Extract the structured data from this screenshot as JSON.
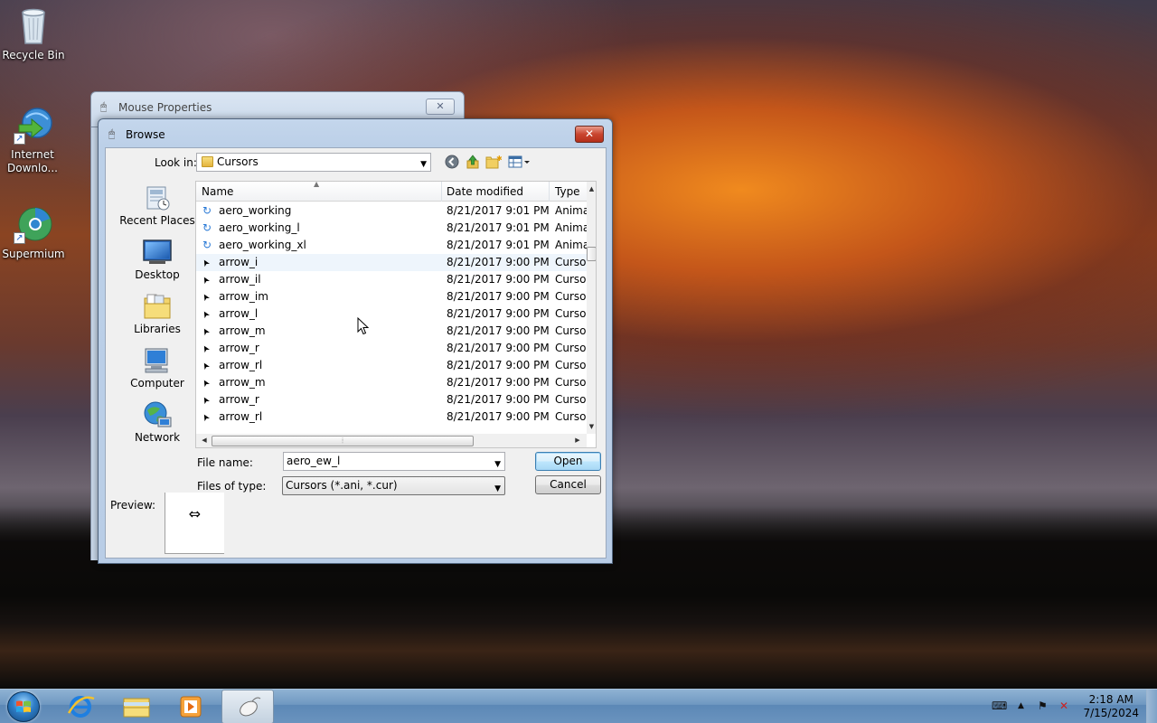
{
  "desktop": {
    "icons": [
      {
        "label": "Recycle Bin",
        "icon": "recycle-bin-icon"
      },
      {
        "label": "Internet Downlo...",
        "icon": "internet-download-manager-icon"
      },
      {
        "label": "Supermium",
        "icon": "supermium-browser-icon"
      }
    ]
  },
  "back_window": {
    "title": "Mouse Properties",
    "close_label": "✕"
  },
  "dialog": {
    "title": "Browse",
    "close_label": "✕",
    "look_in_label": "Look in:",
    "look_in_value": "Cursors",
    "toolbar_icons": [
      "back-icon",
      "up-folder-icon",
      "new-folder-icon",
      "views-menu-icon"
    ],
    "places": [
      {
        "label": "Recent Places",
        "icon": "recent-places-icon"
      },
      {
        "label": "Desktop",
        "icon": "desktop-icon"
      },
      {
        "label": "Libraries",
        "icon": "libraries-icon"
      },
      {
        "label": "Computer",
        "icon": "computer-icon"
      },
      {
        "label": "Network",
        "icon": "network-icon"
      }
    ],
    "columns": {
      "name": "Name",
      "date": "Date modified",
      "type": "Type"
    },
    "files": [
      {
        "name": "aero_working",
        "date": "8/21/2017 9:01 PM",
        "type": "Anima",
        "icon": "animated-cursor-icon"
      },
      {
        "name": "aero_working_l",
        "date": "8/21/2017 9:01 PM",
        "type": "Anima",
        "icon": "animated-cursor-icon"
      },
      {
        "name": "aero_working_xl",
        "date": "8/21/2017 9:01 PM",
        "type": "Anima",
        "icon": "animated-cursor-icon"
      },
      {
        "name": "arrow_i",
        "date": "8/21/2017 9:00 PM",
        "type": "Cursor",
        "icon": "arrow-cursor-icon"
      },
      {
        "name": "arrow_il",
        "date": "8/21/2017 9:00 PM",
        "type": "Cursor",
        "icon": "arrow-cursor-icon"
      },
      {
        "name": "arrow_im",
        "date": "8/21/2017 9:00 PM",
        "type": "Cursor",
        "icon": "arrow-cursor-icon"
      },
      {
        "name": "arrow_l",
        "date": "8/21/2017 9:00 PM",
        "type": "Cursor",
        "icon": "arrow-cursor-icon"
      },
      {
        "name": "arrow_m",
        "date": "8/21/2017 9:00 PM",
        "type": "Cursor",
        "icon": "arrow-cursor-icon"
      },
      {
        "name": "arrow_r",
        "date": "8/21/2017 9:00 PM",
        "type": "Cursor",
        "icon": "arrow-cursor-icon"
      },
      {
        "name": "arrow_rl",
        "date": "8/21/2017 9:00 PM",
        "type": "Cursor",
        "icon": "arrow-cursor-icon"
      },
      {
        "name": "arrow_m",
        "date": "8/21/2017 9:00 PM",
        "type": "Cursor",
        "icon": "arrow-cursor-icon"
      },
      {
        "name": "arrow_r",
        "date": "8/21/2017 9:00 PM",
        "type": "Cursor",
        "icon": "arrow-cursor-icon"
      },
      {
        "name": "arrow_rl",
        "date": "8/21/2017 9:00 PM",
        "type": "Cursor",
        "icon": "arrow-cursor-icon"
      }
    ],
    "file_name_label": "File name:",
    "file_name_value": "aero_ew_l",
    "files_of_type_label": "Files of type:",
    "files_of_type_value": "Cursors (*.ani, *.cur)",
    "open_label": "Open",
    "cancel_label": "Cancel",
    "preview_label": "Preview:",
    "preview_glyph": "⇔"
  },
  "taskbar": {
    "items": [
      {
        "icon": "internet-explorer-icon"
      },
      {
        "icon": "file-explorer-icon"
      },
      {
        "icon": "media-player-icon"
      },
      {
        "icon": "mouse-properties-icon"
      }
    ],
    "time": "2:18 AM",
    "date": "7/15/2024"
  },
  "colors": {
    "accent": "#3c7fb1",
    "close_red": "#c9452e",
    "taskbar": "#6f98c1"
  }
}
